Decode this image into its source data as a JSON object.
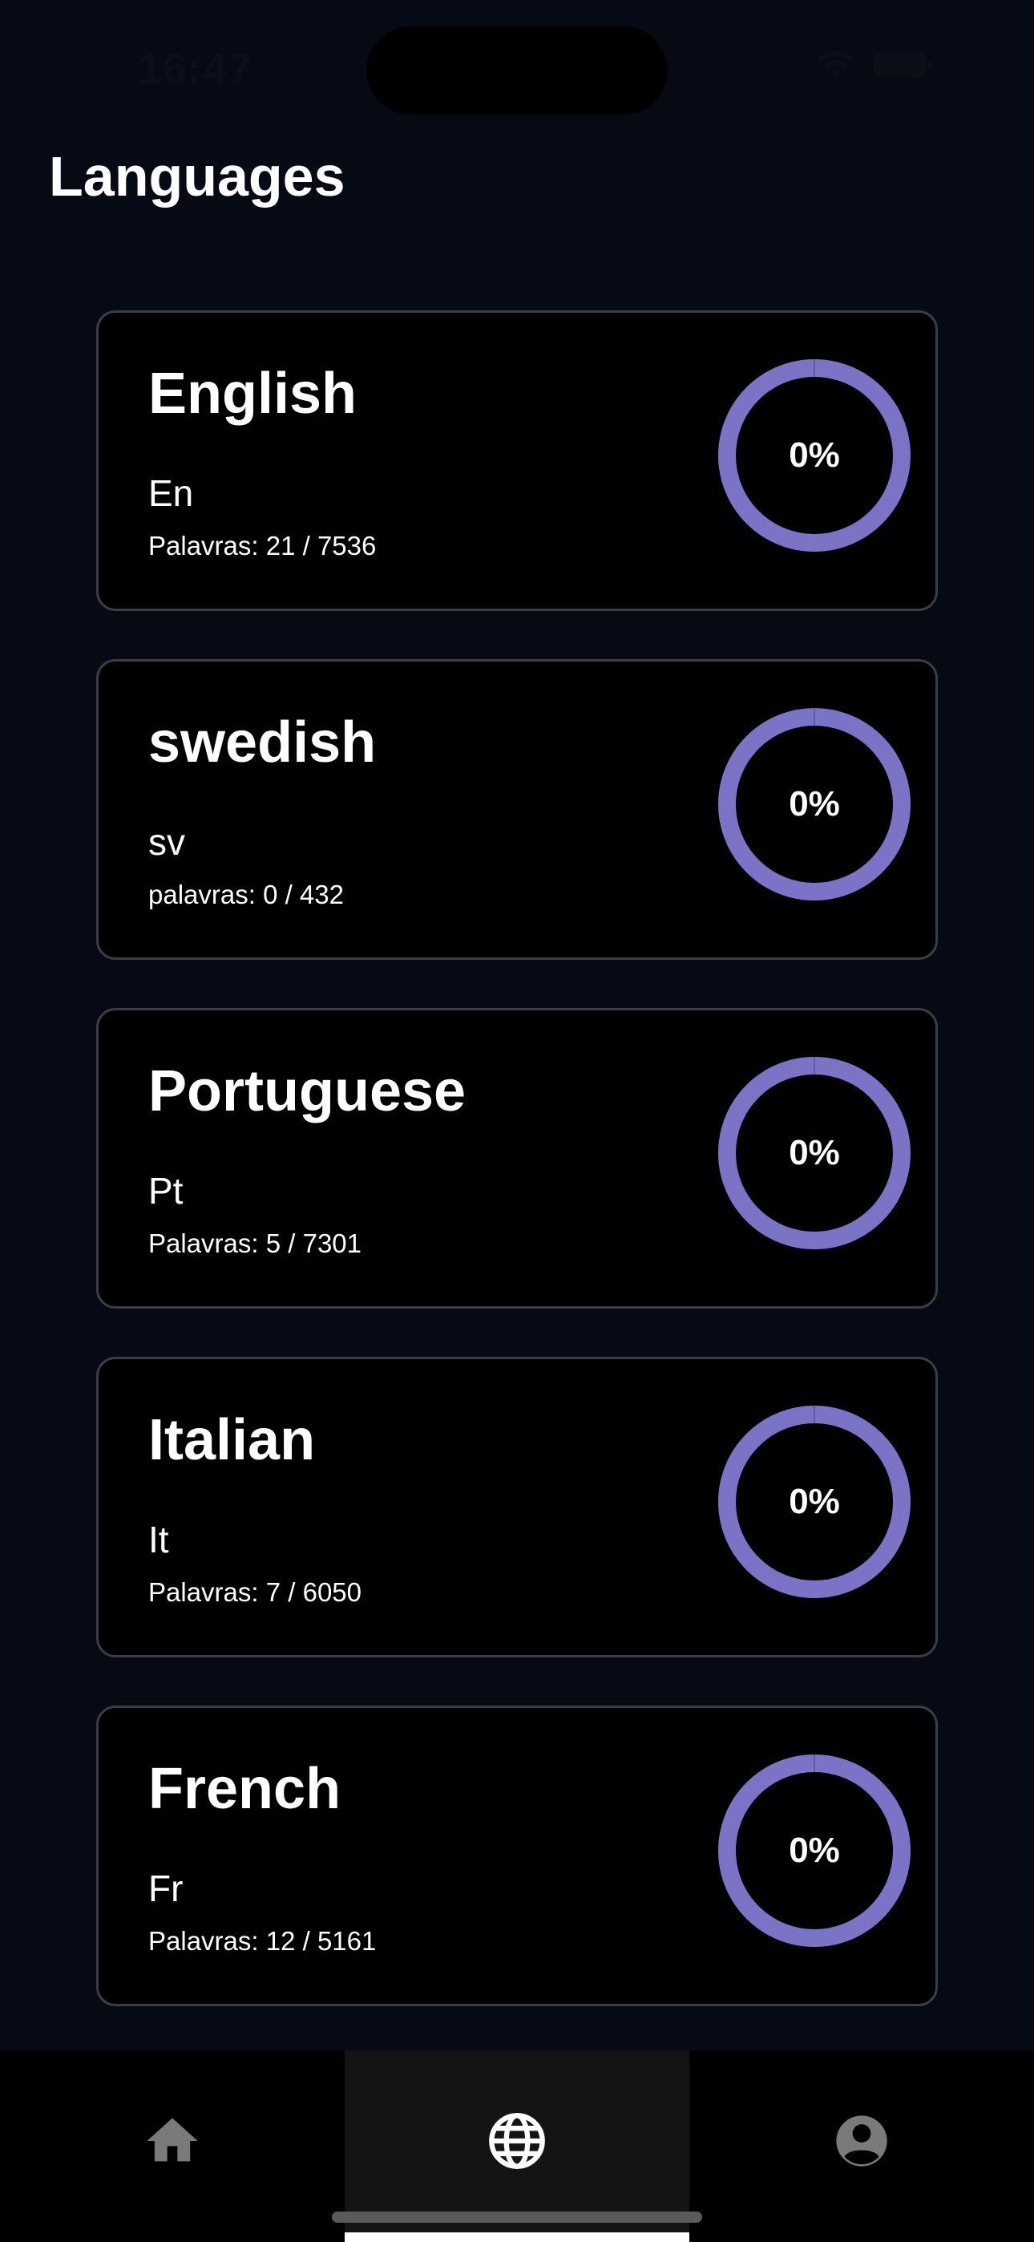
{
  "status_bar": {
    "time": "16:47"
  },
  "header": {
    "title": "Languages"
  },
  "colors": {
    "background": "#050a14",
    "card_background": "#000000",
    "card_border": "#3a3d45",
    "progress_ring": "#7b73c6",
    "tab_active_background": "#141414",
    "tab_icon_inactive": "#7a7a7a",
    "tab_icon_active": "#ffffff"
  },
  "languages": [
    {
      "name": "English",
      "code": "En",
      "words": "Palavras: 21 / 7536",
      "progress_label": "0%",
      "progress": 0
    },
    {
      "name": "swedish",
      "code": "sv",
      "words": "palavras: 0 / 432",
      "progress_label": "0%",
      "progress": 0
    },
    {
      "name": "Portuguese",
      "code": "Pt",
      "words": "Palavras: 5 / 7301",
      "progress_label": "0%",
      "progress": 0
    },
    {
      "name": "Italian",
      "code": "It",
      "words": "Palavras: 7 / 6050",
      "progress_label": "0%",
      "progress": 0
    },
    {
      "name": "French",
      "code": "Fr",
      "words": "Palavras: 12 / 5161",
      "progress_label": "0%",
      "progress": 0
    }
  ],
  "tab_bar": {
    "tabs": [
      {
        "icon": "home-icon",
        "active": false
      },
      {
        "icon": "globe-icon",
        "active": true
      },
      {
        "icon": "profile-icon",
        "active": false
      }
    ]
  }
}
